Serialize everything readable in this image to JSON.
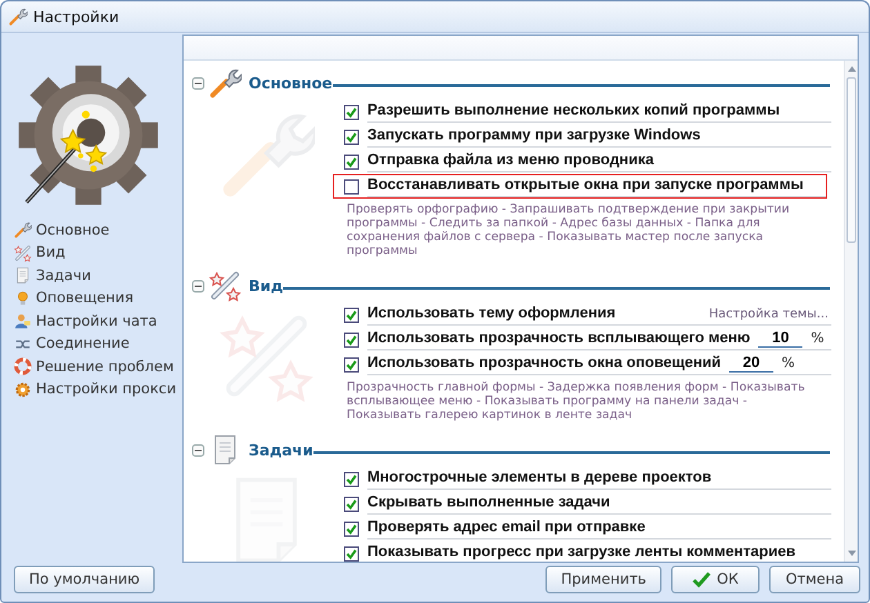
{
  "window": {
    "title": "Настройки"
  },
  "sidebar": {
    "items": [
      {
        "label": "Основное"
      },
      {
        "label": "Вид"
      },
      {
        "label": "Задачи"
      },
      {
        "label": "Оповещения"
      },
      {
        "label": "Настройки чата"
      },
      {
        "label": "Соединение"
      },
      {
        "label": "Решение проблем"
      },
      {
        "label": "Настройки прокси"
      }
    ]
  },
  "sections": [
    {
      "title": "Основное",
      "expanded": true,
      "options": [
        {
          "label": "Разрешить выполнение нескольких копий программы",
          "checked": true,
          "highlighted": false
        },
        {
          "label": "Запускать программу при загрузке Windows",
          "checked": true,
          "highlighted": false
        },
        {
          "label": "Отправка файла из меню проводника",
          "checked": true,
          "highlighted": false
        },
        {
          "label": "Восстанавливать открытые окна при запуске программы",
          "checked": false,
          "highlighted": true
        }
      ],
      "description": "Проверять орфографию - Запрашивать подтверждение при закрытии программы - Следить за папкой - Адрес базы данных - Папка для сохранения файлов с сервера - Показывать мастер после запуска программы"
    },
    {
      "title": "Вид",
      "expanded": true,
      "options": [
        {
          "label": "Использовать тему оформления",
          "checked": true,
          "highlighted": false,
          "link": "Настройка темы..."
        },
        {
          "label": "Использовать прозрачность всплывающего меню",
          "checked": true,
          "highlighted": false,
          "value": "10",
          "unit": "%"
        },
        {
          "label": "Использовать прозрачность окна оповещений",
          "checked": true,
          "highlighted": false,
          "value": "20",
          "unit": "%"
        }
      ],
      "description": "Прозрачность главной формы - Задержка появления форм - Показывать всплывающее меню - Показывать программу на панели задач - Показывать галерею картинок в ленте задач"
    },
    {
      "title": "Задачи",
      "expanded": true,
      "options": [
        {
          "label": "Многострочные элементы в дереве проектов",
          "checked": true,
          "highlighted": false
        },
        {
          "label": "Скрывать выполненные задачи",
          "checked": true,
          "highlighted": false
        },
        {
          "label": "Проверять адрес email при отправке",
          "checked": true,
          "highlighted": false
        },
        {
          "label": "Показывать прогресс при загрузке ленты комментариев",
          "checked": true,
          "highlighted": false
        }
      ]
    }
  ],
  "buttons": {
    "defaults": "По умолчанию",
    "apply": "Применить",
    "ok": "ОК",
    "cancel": "Отмена"
  }
}
